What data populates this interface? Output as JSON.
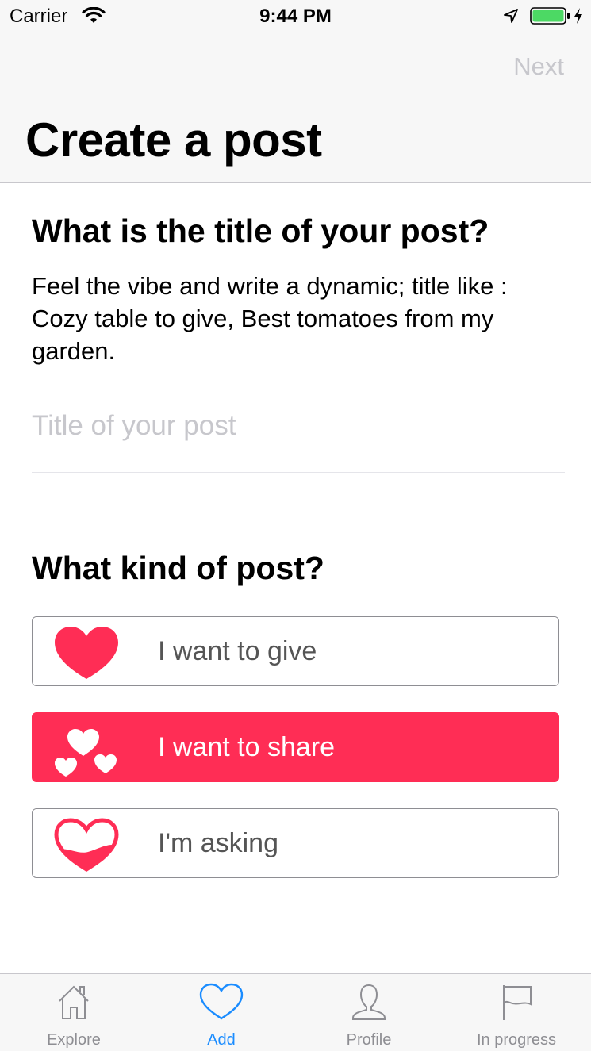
{
  "status_bar": {
    "carrier": "Carrier",
    "time": "9:44 PM",
    "icons": [
      "wifi-icon",
      "location-icon",
      "battery-icon",
      "charging-icon"
    ]
  },
  "nav": {
    "next_label": "Next",
    "title": "Create a post"
  },
  "title_section": {
    "heading": "What is the title of your post?",
    "description": "Feel the vibe and write a dynamic; title like : Cozy table to give, Best tomatoes from my garden.",
    "input_placeholder": "Title of your post",
    "input_value": ""
  },
  "kind_section": {
    "heading": "What kind of post?",
    "options": [
      {
        "label": "I want to give",
        "icon": "heart-icon",
        "selected": false
      },
      {
        "label": "I want to share",
        "icon": "hearts-share-icon",
        "selected": true
      },
      {
        "label": "I'm asking",
        "icon": "heart-half-filled-icon",
        "selected": false
      }
    ]
  },
  "tab_bar": {
    "tabs": [
      {
        "label": "Explore",
        "icon": "home-icon",
        "active": false
      },
      {
        "label": "Add",
        "icon": "heart-outline-icon",
        "active": true
      },
      {
        "label": "Profile",
        "icon": "person-icon",
        "active": false
      },
      {
        "label": "In progress",
        "icon": "flag-icon",
        "active": false
      }
    ]
  },
  "colors": {
    "accent_pink": "#ff2d55",
    "tab_active_blue": "#1a8cff",
    "inactive_gray": "#8e8e93",
    "placeholder_gray": "#c7c7cc",
    "battery_green": "#4cd964"
  }
}
